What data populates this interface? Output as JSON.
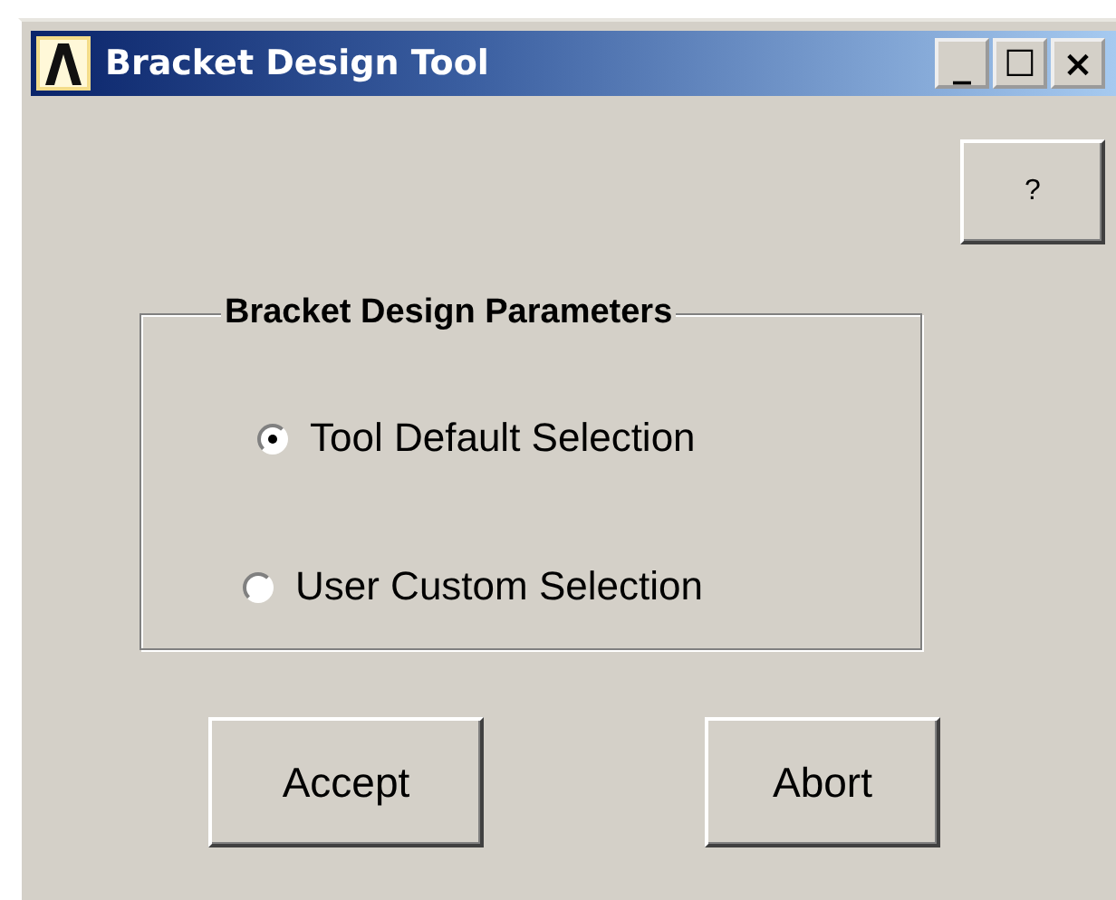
{
  "window": {
    "title": "Bracket Design Tool",
    "controls": [
      "_",
      "☐",
      "×"
    ]
  },
  "help_button": {
    "label": "?"
  },
  "group": {
    "title": "Bracket Design Parameters",
    "options": [
      {
        "label": "Tool Default Selection",
        "selected": true
      },
      {
        "label": "User Custom Selection",
        "selected": false
      }
    ]
  },
  "buttons": [
    "Accept",
    "Abort"
  ]
}
